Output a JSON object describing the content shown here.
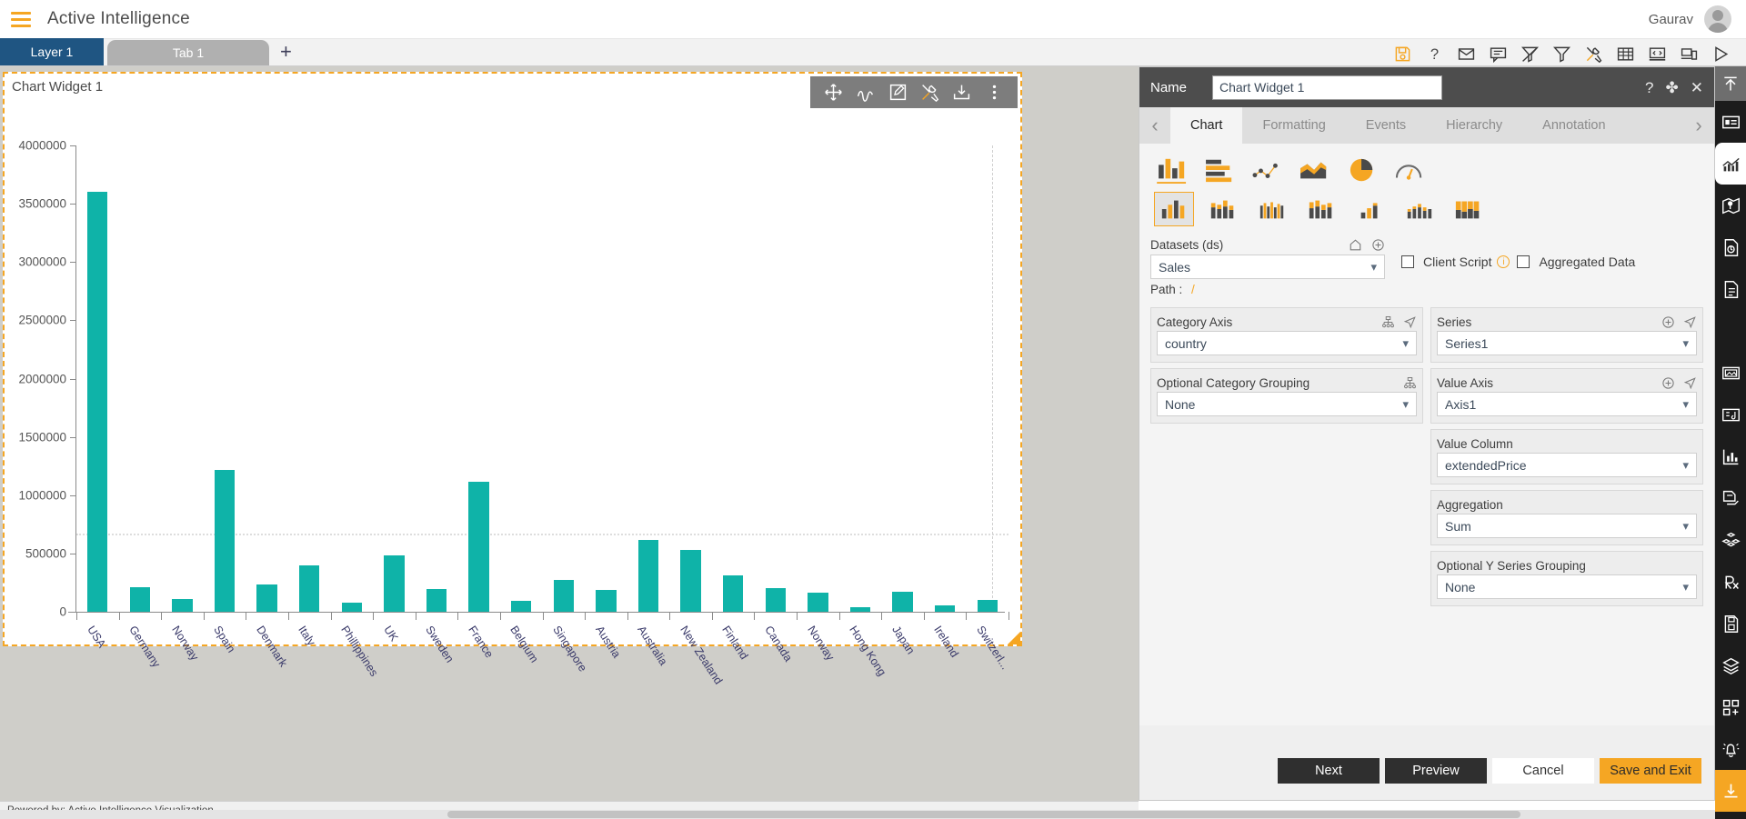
{
  "app": {
    "title": "Active Intelligence",
    "user": "Gaurav",
    "menu_icon": "hamburger-icon",
    "avatar_icon": "user-avatar-icon"
  },
  "tabstrip": {
    "layer_tab": "Layer 1",
    "page_tab": "Tab 1",
    "add_tab": "+",
    "tools": [
      {
        "name": "save-icon",
        "title": "Save"
      },
      {
        "name": "help-icon",
        "title": "Help"
      },
      {
        "name": "mail-icon",
        "title": "Mail"
      },
      {
        "name": "comment-icon",
        "title": "Comment"
      },
      {
        "name": "clear-filter-icon",
        "title": "Clear Filter"
      },
      {
        "name": "filter-icon",
        "title": "Filter"
      },
      {
        "name": "tools-icon",
        "title": "Tools"
      },
      {
        "name": "table-icon",
        "title": "Table"
      },
      {
        "name": "code-icon",
        "title": "Code"
      },
      {
        "name": "devices-icon",
        "title": "Devices"
      },
      {
        "name": "play-icon",
        "title": "Run"
      }
    ]
  },
  "widget": {
    "title": "Chart Widget 1",
    "toolbar": [
      {
        "name": "move-icon",
        "title": "Move"
      },
      {
        "name": "scribble-icon",
        "title": "Draw"
      },
      {
        "name": "edit-icon",
        "title": "Edit"
      },
      {
        "name": "tools-icon",
        "title": "Tools"
      },
      {
        "name": "download-icon",
        "title": "Download"
      },
      {
        "name": "more-options-icon",
        "title": "More"
      }
    ]
  },
  "chart_data": {
    "type": "bar",
    "title": "Chart Widget 1",
    "xlabel": "country",
    "ylabel": "",
    "ylim": [
      0,
      4000000
    ],
    "yticks": [
      0,
      500000,
      1000000,
      1500000,
      2000000,
      2500000,
      3000000,
      3500000,
      4000000
    ],
    "grid": false,
    "series_name": "Series1",
    "value_column": "extendedPrice",
    "aggregation": "Sum",
    "bar_color": "#0fb3a8",
    "categories": [
      "USA",
      "Germany",
      "Norway",
      "Spain",
      "Denmark",
      "Italy",
      "Phillippines",
      "UK",
      "Sweden",
      "France",
      "Belgium",
      "Singapore",
      "Austria",
      "Australia",
      "New Zealand",
      "Finland",
      "Canada",
      "Norway",
      "Hong Kong",
      "Japan",
      "Ireland",
      "Switzerl..."
    ],
    "values": [
      3605000,
      210000,
      110000,
      1215000,
      235000,
      395000,
      80000,
      480000,
      195000,
      1115000,
      95000,
      275000,
      190000,
      615000,
      530000,
      310000,
      205000,
      165000,
      40000,
      170000,
      55000,
      100000
    ]
  },
  "panel": {
    "name_label": "Name",
    "name_value": "Chart Widget 1",
    "head_actions": [
      {
        "name": "help-icon",
        "glyph": "?"
      },
      {
        "name": "move-icon",
        "glyph": "✤"
      },
      {
        "name": "close-icon",
        "glyph": "✕"
      }
    ],
    "tabs": [
      {
        "label": "Chart",
        "active": true
      },
      {
        "label": "Formatting",
        "active": false
      },
      {
        "label": "Events",
        "active": false
      },
      {
        "label": "Hierarchy",
        "active": false
      },
      {
        "label": "Annotation",
        "active": false
      }
    ],
    "prev_arrow": "‹",
    "next_arrow": "›",
    "chart_types": [
      {
        "name": "column-chart-icon",
        "selected": true
      },
      {
        "name": "bar-chart-icon",
        "selected": false
      },
      {
        "name": "scatter-chart-icon",
        "selected": false
      },
      {
        "name": "area-chart-icon",
        "selected": false
      },
      {
        "name": "pie-chart-icon",
        "selected": false
      },
      {
        "name": "gauge-chart-icon",
        "selected": false
      }
    ],
    "chart_subtypes": [
      {
        "name": "clustered-column-icon",
        "selected": true
      },
      {
        "name": "stacked-column-icon",
        "selected": false
      },
      {
        "name": "multi-column-icon",
        "selected": false
      },
      {
        "name": "stacked-group-column-icon",
        "selected": false
      },
      {
        "name": "small-column-icon",
        "selected": false
      },
      {
        "name": "mixed-column-icon",
        "selected": false
      },
      {
        "name": "full-stacked-column-icon",
        "selected": false
      }
    ],
    "datasets": {
      "label": "Datasets (ds)",
      "value": "Sales",
      "path_label": "Path :",
      "path_value": "/",
      "home_icon": "home-icon",
      "add_icon": "add-circle-icon"
    },
    "client_script": {
      "label": "Client Script",
      "checked": false,
      "info_icon": "info-icon"
    },
    "aggregated_data": {
      "label": "Aggregated Data",
      "checked": false
    },
    "category_axis": {
      "label": "Category Axis",
      "value": "country",
      "icons": [
        "hierarchy-icon",
        "send-icon"
      ]
    },
    "optional_category_grouping": {
      "label": "Optional Category Grouping",
      "value": "None",
      "icons": [
        "hierarchy-icon"
      ]
    },
    "series": {
      "label": "Series",
      "value": "Series1",
      "icons": [
        "add-circle-icon",
        "send-icon"
      ]
    },
    "value_axis": {
      "label": "Value Axis",
      "value": "Axis1",
      "icons": [
        "add-circle-icon",
        "send-icon"
      ]
    },
    "value_column": {
      "label": "Value Column",
      "value": "extendedPrice"
    },
    "aggregation": {
      "label": "Aggregation",
      "value": "Sum"
    },
    "optional_y_series_grouping": {
      "label": "Optional Y Series Grouping",
      "value": "None"
    },
    "buttons": [
      {
        "label": "Next",
        "style": "dark"
      },
      {
        "label": "Preview",
        "style": "dark"
      },
      {
        "label": "Cancel",
        "style": "light"
      },
      {
        "label": "Save and Exit",
        "style": "orange"
      }
    ]
  },
  "rail": {
    "top": {
      "name": "collapse-up-icon"
    },
    "items": [
      {
        "name": "widget-panel-icon",
        "state": "normal"
      },
      {
        "name": "chart-widget-icon",
        "state": "active"
      },
      {
        "name": "map-widget-icon",
        "state": "normal"
      },
      {
        "name": "document-refresh-icon",
        "state": "normal"
      },
      {
        "name": "document-icon",
        "state": "normal"
      },
      {
        "name": "braces-icon",
        "state": "normal"
      },
      {
        "name": "image-widget-icon",
        "state": "normal"
      },
      {
        "name": "media-widget-icon",
        "state": "normal"
      },
      {
        "name": "analytics-icon",
        "state": "normal"
      },
      {
        "name": "copy-page-icon",
        "state": "normal"
      },
      {
        "name": "cubes-icon",
        "state": "normal"
      },
      {
        "name": "prescription-icon",
        "state": "normal"
      },
      {
        "name": "report-save-icon",
        "state": "normal"
      },
      {
        "name": "layers-icon",
        "state": "normal"
      },
      {
        "name": "add-grid-icon",
        "state": "normal"
      },
      {
        "name": "alert-bell-icon",
        "state": "normal"
      },
      {
        "name": "download-icon",
        "state": "orange"
      }
    ]
  },
  "footer": {
    "text": "Powered by: Active Intelligence Visualization"
  }
}
